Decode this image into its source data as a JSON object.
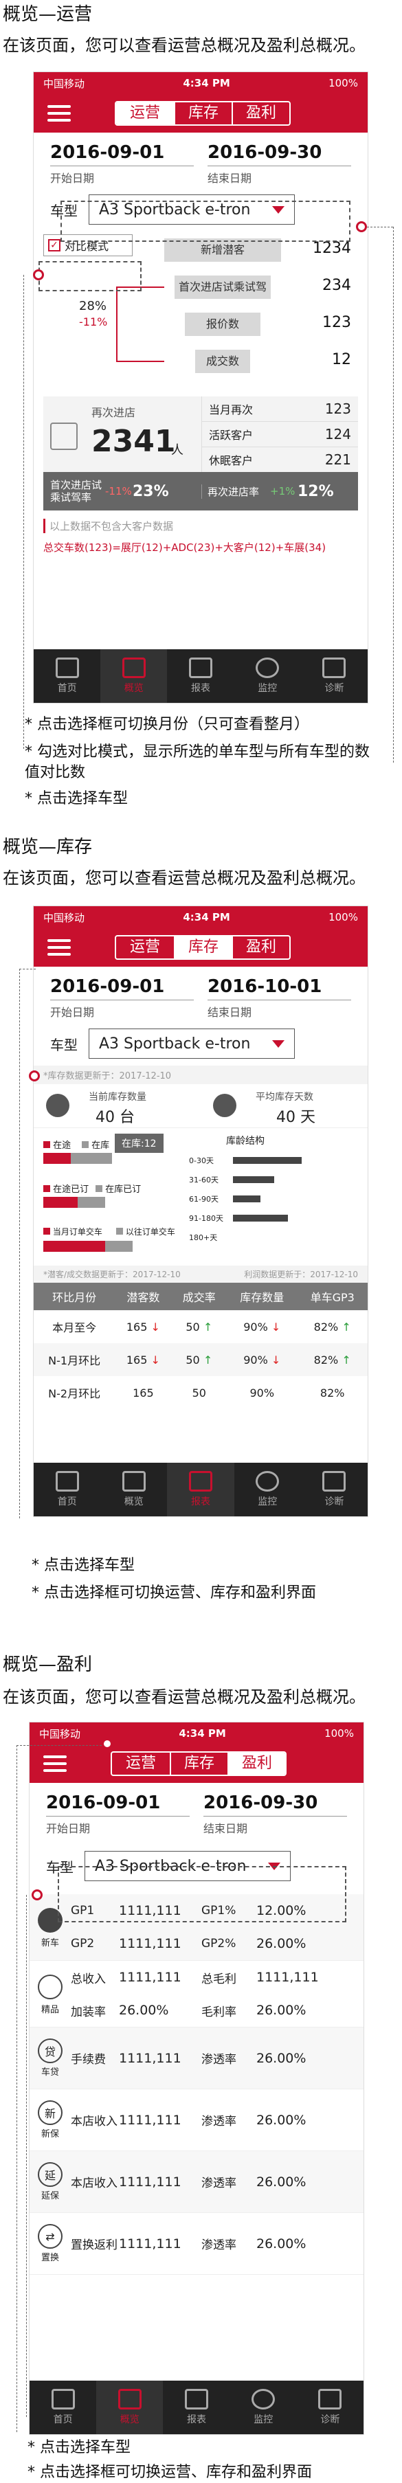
{
  "sections": {
    "s1": {
      "title": "概览—运营",
      "intro": "在该页面，您可以查看运营总概况及盈利总概况。"
    },
    "s2": {
      "title": "概览—库存",
      "intro": "在该页面，您可以查看运营总概况及盈利总概况。"
    },
    "s3": {
      "title": "概览—盈利",
      "intro": "在该页面，您可以查看运营总概况及盈利总概况。"
    }
  },
  "status": {
    "carrier": "中国移动",
    "time": "4:34 PM",
    "battery": "100%"
  },
  "tabs": [
    "运营",
    "库存",
    "盈利"
  ],
  "nav": [
    "首页",
    "概览",
    "报表",
    "监控",
    "诊断"
  ],
  "screen1": {
    "start_date": "2016-09-01",
    "start_label": "开始日期",
    "end_date": "2016-09-30",
    "end_label": "结束日期",
    "car_label": "车型",
    "car_value": "A3 Sportback e-tron",
    "compare_label": "对比模式",
    "funnel": [
      {
        "label": "新增潜客",
        "value": "1234"
      },
      {
        "label": "首次进店试乘试驾",
        "value": "234"
      },
      {
        "label": "报价数",
        "value": "123"
      },
      {
        "label": "成交数",
        "value": "12"
      }
    ],
    "conv_pct": "28%",
    "conv_diff": "-11%",
    "revisit_label": "再次进店",
    "revisit_value": "2341",
    "revisit_unit": "人",
    "side": [
      {
        "label": "当月再次",
        "value": "123"
      },
      {
        "label": "活跃客户",
        "value": "124"
      },
      {
        "label": "休眠客户",
        "value": "221"
      }
    ],
    "rate1_label": "首次进店试乘试驾率",
    "rate1_diff": "-11%",
    "rate1_value": "23%",
    "rate2_label": "再次进店率",
    "rate2_diff": "+1%",
    "rate2_value": "12%",
    "footnote": "以上数据不包含大客户数据",
    "formula": "总交车数(123)=展厅(12)+ADC(23)+大客户(12)+车展(34)",
    "notes": [
      "*  点击选择框可切换月份（只可查看整月）",
      "*  勾选对比模式，显示所选的单车型与所有车型的数值对比数",
      "*  点击选择车型"
    ]
  },
  "screen2": {
    "start_date": "2016-09-01",
    "start_label": "开始日期",
    "end_date": "2016-10-01",
    "end_label": "结束日期",
    "car_label": "车型",
    "car_value": "A3 Sportback e-tron",
    "update1": "*库存数据更新于：2017-12-10",
    "stock_label": "当前库存数量",
    "stock_value": "40 台",
    "age_label": "平均库存天数",
    "age_value": "40 天",
    "legend": [
      "在途",
      "在库",
      "在库:12",
      "在途已订",
      "在库已订",
      "当月订单交车",
      "以往订单交车"
    ],
    "age_title": "库龄结构",
    "age_buckets": [
      "0-30天",
      "31-60天",
      "61-90天",
      "91-180天",
      "180+天"
    ],
    "update2": "*潜客/成交数据更新于：2017-12-10",
    "update3": "利润数据更新于：2017-12-10",
    "cols": [
      "环比月份",
      "潜客数",
      "成交率",
      "库存数量",
      "单车GP3"
    ],
    "rows": [
      [
        "本月至今",
        "165",
        "50",
        "90%",
        "82%"
      ],
      [
        "N-1月环比",
        "165",
        "50",
        "90%",
        "82%"
      ],
      [
        "N-2月环比",
        "165",
        "50",
        "90%",
        "82%"
      ]
    ],
    "notes": [
      "*  点击选择车型",
      "* 点击选择框可切换运营、库存和盈利界面"
    ]
  },
  "screen3": {
    "start_date": "2016-09-01",
    "start_label": "开始日期",
    "end_date": "2016-09-30",
    "end_label": "结束日期",
    "car_label": "车型",
    "car_value": "A3 Sportback e-tron",
    "rows": [
      {
        "icon": "新车",
        "items": [
          [
            "GP1",
            "1111,111",
            "GP1%",
            "12.00%"
          ],
          [
            "GP2",
            "1111,111",
            "GP2%",
            "26.00%"
          ]
        ]
      },
      {
        "icon": "精品",
        "items": [
          [
            "总收入",
            "1111,111",
            "总毛利",
            "1111,111"
          ],
          [
            "加装率",
            "26.00%",
            "毛利率",
            "26.00%"
          ]
        ]
      },
      {
        "icon": "车贷",
        "items": [
          [
            "手续费",
            "1111,111",
            "渗透率",
            "26.00%"
          ]
        ]
      },
      {
        "icon": "新保",
        "items": [
          [
            "本店收入",
            "1111,111",
            "渗透率",
            "26.00%"
          ]
        ]
      },
      {
        "icon": "延保",
        "items": [
          [
            "本店收入",
            "1111,111",
            "渗透率",
            "26.00%"
          ]
        ]
      },
      {
        "icon": "置换",
        "items": [
          [
            "置换返利",
            "1111,111",
            "渗透率",
            "26.00%"
          ]
        ]
      }
    ],
    "notes": [
      "*  点击选择车型",
      "* 点击选择框可切换运营、库存和盈利界面"
    ]
  }
}
